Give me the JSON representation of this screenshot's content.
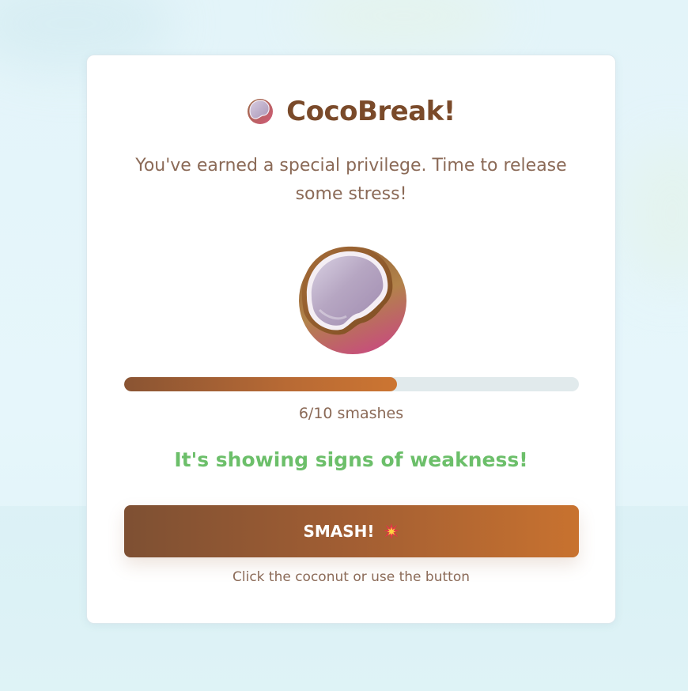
{
  "app": {
    "title": "CocoBreak!",
    "title_icon": "coconut-icon",
    "subtitle": "You've earned a special privilege. Time to release some stress!"
  },
  "game": {
    "smashes_done": 6,
    "smashes_total": 10,
    "progress_fraction": 0.6,
    "progress_label": "6/10 smashes",
    "status_message": "It's showing signs of weakness!",
    "coconut_icon": "cracked-coconut-icon"
  },
  "actions": {
    "smash_label": "SMASH!",
    "smash_icon": "collision-burst-icon",
    "hint": "Click the coconut or use the button"
  },
  "colors": {
    "brand_brown": "#7a4a2a",
    "status_green": "#6cbf6a",
    "button_start": "#7e5033",
    "button_end": "#c8722f",
    "track": "#e1eaec"
  }
}
